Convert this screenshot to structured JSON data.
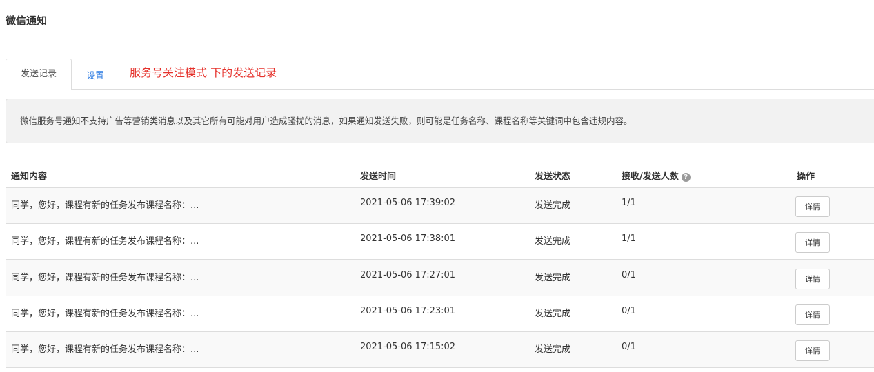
{
  "page": {
    "title": "微信通知"
  },
  "tabs": [
    {
      "label": "发送记录",
      "active": true
    },
    {
      "label": "设置",
      "active": false
    }
  ],
  "annotation": "服务号关注模式 下的发送记录",
  "notice": "微信服务号通知不支持广告等营销类消息以及其它所有可能对用户造成骚扰的消息，如果通知发送失败，则可能是任务名称、课程名称等关键词中包含违规内容。",
  "table": {
    "headers": {
      "content": "通知内容",
      "time": "发送时间",
      "status": "发送状态",
      "count": "接收/发送人数",
      "action": "操作"
    },
    "help_icon": "question-circle-icon",
    "rows": [
      {
        "content": "同学，您好，课程有新的任务发布课程名称：...",
        "time": "2021-05-06 17:39:02",
        "status": "发送完成",
        "count": "1/1",
        "action": "详情"
      },
      {
        "content": "同学，您好，课程有新的任务发布课程名称：...",
        "time": "2021-05-06 17:38:01",
        "status": "发送完成",
        "count": "1/1",
        "action": "详情"
      },
      {
        "content": "同学，您好，课程有新的任务发布课程名称：...",
        "time": "2021-05-06 17:27:01",
        "status": "发送完成",
        "count": "0/1",
        "action": "详情"
      },
      {
        "content": "同学，您好，课程有新的任务发布课程名称：...",
        "time": "2021-05-06 17:23:01",
        "status": "发送完成",
        "count": "0/1",
        "action": "详情"
      },
      {
        "content": "同学，您好，课程有新的任务发布课程名称：...",
        "time": "2021-05-06 17:15:02",
        "status": "发送完成",
        "count": "0/1",
        "action": "详情"
      }
    ]
  },
  "colors": {
    "link": "#2a7ae2",
    "annotation": "#e5312b",
    "notice_bg": "#f2f2f2"
  }
}
